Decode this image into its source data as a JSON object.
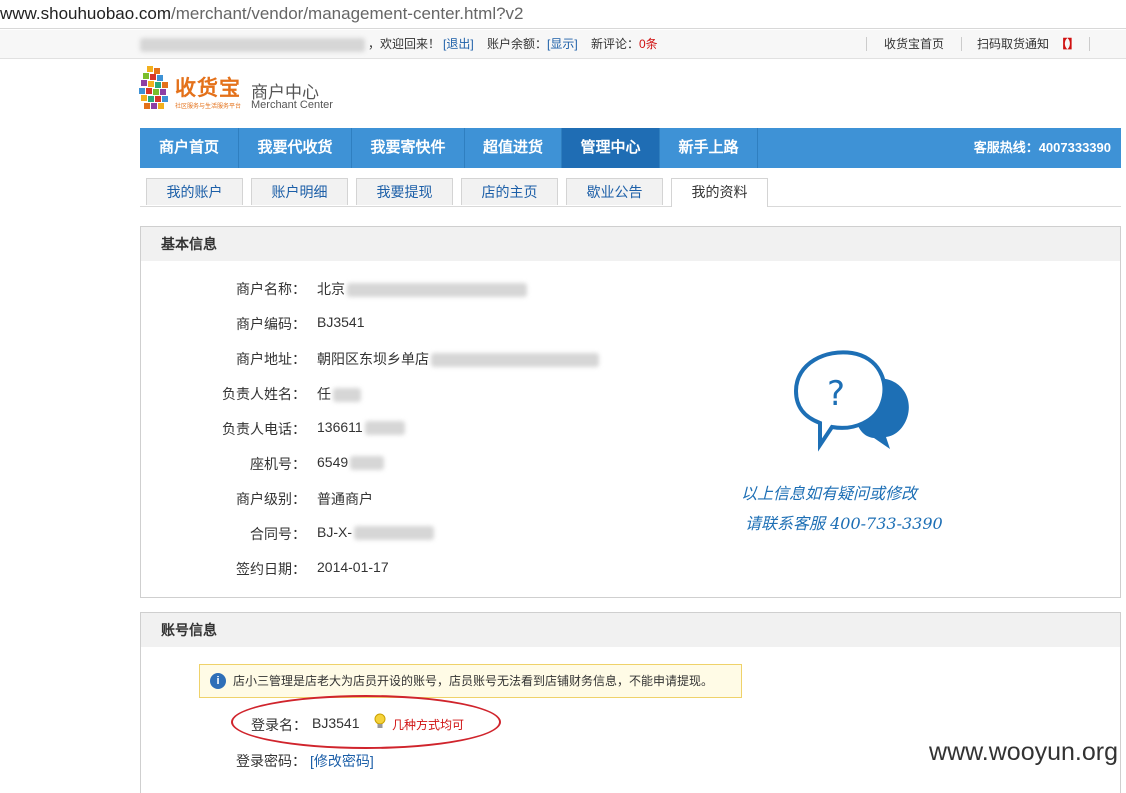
{
  "url": {
    "host": "www.shouhuobao.com",
    "path": "/merchant/vendor/management-center.html?v2"
  },
  "topbar": {
    "welcome": "，欢迎回来！",
    "logout": "[退出]",
    "balance_label": "账户余额：",
    "balance_show": "[显示]",
    "comments_label": "新评论：",
    "comments_count": "0条",
    "home_link": "收货宝首页",
    "scan_notice": "扫码取货通知"
  },
  "logo": {
    "brand": "收货宝",
    "tagline": "社区服务与生活服务平台",
    "center_cn": "商户中心",
    "center_en": "Merchant Center"
  },
  "nav": {
    "items": [
      {
        "label": "商户首页"
      },
      {
        "label": "我要代收货"
      },
      {
        "label": "我要寄快件"
      },
      {
        "label": "超值进货"
      },
      {
        "label": "管理中心"
      },
      {
        "label": "新手上路"
      }
    ],
    "active_index": 4,
    "hotline": "客服热线：4007333390"
  },
  "subtabs": {
    "items": [
      {
        "label": "我的账户"
      },
      {
        "label": "账户明细"
      },
      {
        "label": "我要提现"
      },
      {
        "label": "店的主页"
      },
      {
        "label": "歇业公告"
      },
      {
        "label": "我的资料"
      }
    ],
    "active_index": 5
  },
  "basic": {
    "title": "基本信息",
    "fields": [
      {
        "label": "商户名称：",
        "value": "北京"
      },
      {
        "label": "商户编码：",
        "value": "BJ3541"
      },
      {
        "label": "商户地址：",
        "value": "朝阳区东坝乡单店"
      },
      {
        "label": "负责人姓名：",
        "value": "任"
      },
      {
        "label": "负责人电话：",
        "value": "136611"
      },
      {
        "label": "座机号：",
        "value": "6549"
      },
      {
        "label": "商户级别：",
        "value": "普通商户"
      },
      {
        "label": "合同号：",
        "value": "BJ-X-"
      },
      {
        "label": "签约日期：",
        "value": "2014-01-17"
      }
    ],
    "help_line1": "以上信息如有疑问或修改",
    "help_line2": "请联系客服 400-733-3390"
  },
  "account": {
    "title": "账号信息",
    "notice": "店小三管理是店老大为店员开设的账号，店员账号无法看到店铺财务信息，不能申请提现。",
    "login_label": "登录名：",
    "login_value": "BJ3541",
    "login_hint": "几种方式均可",
    "password_label": "登录密码：",
    "password_link": "[修改密码]"
  },
  "watermark": "www.wooyun.org",
  "colors": {
    "nav_bg": "#3e92d6",
    "nav_active": "#1f6db4",
    "link": "#1c5fa8",
    "alert_red": "#d01010",
    "brand_orange": "#e4711a"
  }
}
